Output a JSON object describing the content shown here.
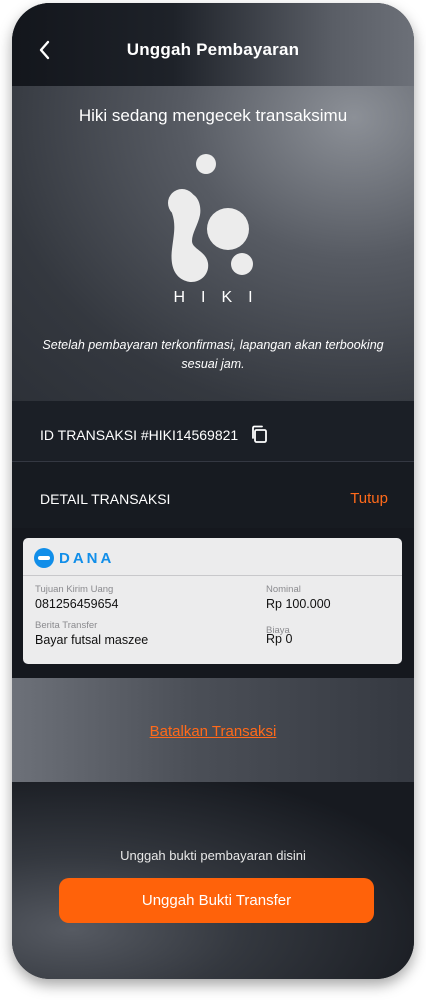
{
  "header": {
    "title": "Unggah Pembayaran",
    "back_icon": "chevron-left-icon"
  },
  "hero": {
    "title": "Hiki sedang mengecek transaksimu",
    "brand_wordmark": "HIKI",
    "note": "Setelah pembayaran terkonfirmasi, lapangan akan terbooking sesuai jam."
  },
  "transaction": {
    "id_label": "ID TRANSAKSI #HIKI14569821",
    "copy_icon": "copy-icon",
    "detail_label": "DETAIL TRANSAKSI",
    "toggle_label": "Tutup"
  },
  "payment_card": {
    "provider": "DANA",
    "destination_label": "Tujuan Kirim Uang",
    "destination_value": "081256459654",
    "nominal_label": "Nominal",
    "nominal_value": "Rp 100.000",
    "message_label": "Berita Transfer",
    "message_value": "Bayar futsal maszee",
    "fee_label": "Biaya",
    "fee_value": "Rp 0"
  },
  "actions": {
    "cancel_label": "Batalkan Transaksi",
    "upload_note": "Unggah bukti pembayaran disini",
    "upload_button": "Unggah Bukti Transfer"
  },
  "colors": {
    "accent": "#ff620a",
    "dana_blue": "#118ee9"
  }
}
